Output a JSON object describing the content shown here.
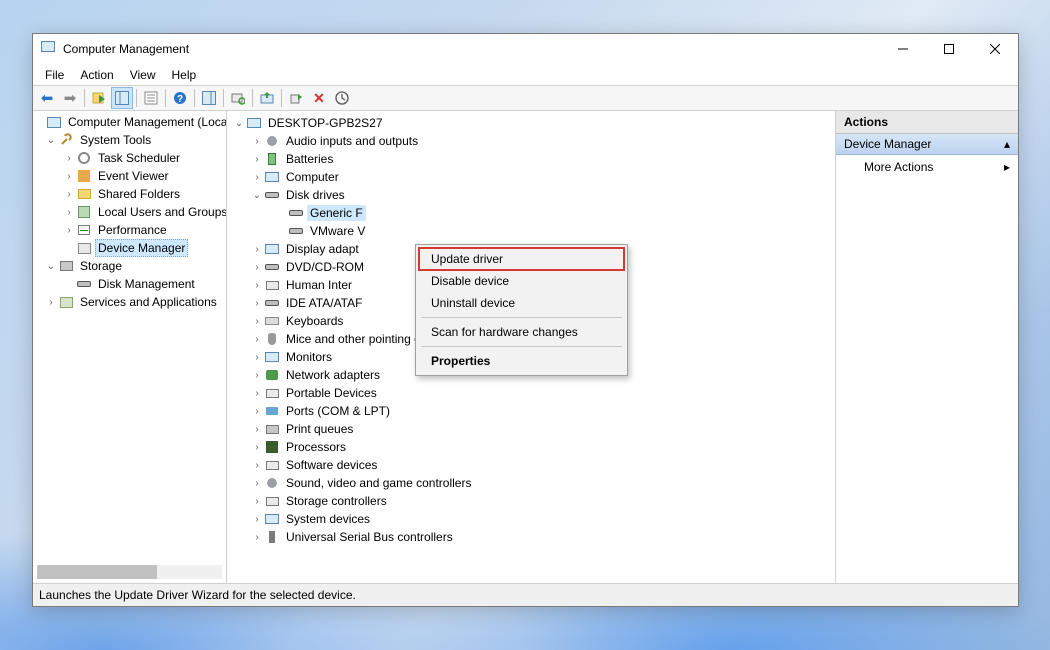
{
  "window": {
    "title": "Computer Management"
  },
  "menubar": [
    "File",
    "Action",
    "View",
    "Help"
  ],
  "left_tree": {
    "root": "Computer Management (Local)",
    "system_tools": {
      "label": "System Tools",
      "children": [
        "Task Scheduler",
        "Event Viewer",
        "Shared Folders",
        "Local Users and Groups",
        "Performance",
        "Device Manager"
      ],
      "selected_index": 5
    },
    "storage": {
      "label": "Storage",
      "children": [
        "Disk Management"
      ]
    },
    "srvapp": "Services and Applications"
  },
  "device_tree": {
    "root": "DESKTOP-GPB2S27",
    "categories": [
      {
        "label": "Audio inputs and outputs",
        "icon": "audio"
      },
      {
        "label": "Batteries",
        "icon": "batt"
      },
      {
        "label": "Computer",
        "icon": "mon"
      },
      {
        "label": "Disk drives",
        "icon": "disk",
        "expanded": true,
        "children": [
          {
            "label": "Generic F",
            "highlighted": true
          },
          {
            "label": "VMware V"
          }
        ]
      },
      {
        "label": "Display adapt",
        "icon": "mon"
      },
      {
        "label": "DVD/CD-ROM",
        "icon": "disk"
      },
      {
        "label": "Human Inter",
        "icon": "dev"
      },
      {
        "label": "IDE ATA/ATAF",
        "icon": "disk"
      },
      {
        "label": "Keyboards",
        "icon": "kbd"
      },
      {
        "label": "Mice and other pointing devices",
        "icon": "mouse"
      },
      {
        "label": "Monitors",
        "icon": "mon"
      },
      {
        "label": "Network adapters",
        "icon": "net"
      },
      {
        "label": "Portable Devices",
        "icon": "dev"
      },
      {
        "label": "Ports (COM & LPT)",
        "icon": "port"
      },
      {
        "label": "Print queues",
        "icon": "print"
      },
      {
        "label": "Processors",
        "icon": "chip"
      },
      {
        "label": "Software devices",
        "icon": "dev"
      },
      {
        "label": "Sound, video and game controllers",
        "icon": "audio"
      },
      {
        "label": "Storage controllers",
        "icon": "dev"
      },
      {
        "label": "System devices",
        "icon": "mon"
      },
      {
        "label": "Universal Serial Bus controllers",
        "icon": "usb"
      }
    ]
  },
  "context_menu": {
    "items": [
      {
        "label": "Update driver",
        "highlight": true
      },
      {
        "label": "Disable device"
      },
      {
        "label": "Uninstall device"
      },
      {
        "sep": true
      },
      {
        "label": "Scan for hardware changes"
      },
      {
        "sep": true
      },
      {
        "label": "Properties",
        "bold": true
      }
    ]
  },
  "actions_pane": {
    "header": "Actions",
    "selected": "Device Manager",
    "more": "More Actions"
  },
  "statusbar": "Launches the Update Driver Wizard for the selected device."
}
